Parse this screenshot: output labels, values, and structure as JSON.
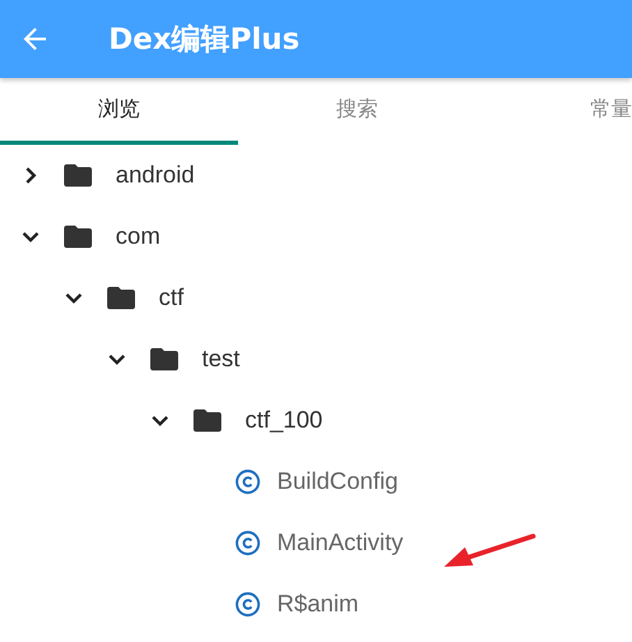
{
  "app_bar": {
    "title": "Dex编辑Plus"
  },
  "tabs": [
    {
      "label": "浏览",
      "selected": true
    },
    {
      "label": "搜索",
      "selected": false
    },
    {
      "label": "常量",
      "selected": false
    }
  ],
  "tree": [
    {
      "kind": "folder",
      "label": "android",
      "expanded": false
    },
    {
      "kind": "folder",
      "label": "com",
      "expanded": true,
      "children": [
        {
          "kind": "folder",
          "label": "ctf",
          "expanded": true,
          "children": [
            {
              "kind": "folder",
              "label": "test",
              "expanded": true,
              "children": [
                {
                  "kind": "folder",
                  "label": "ctf_100",
                  "expanded": true,
                  "children": [
                    {
                      "kind": "class",
                      "label": "BuildConfig"
                    },
                    {
                      "kind": "class",
                      "label": "MainActivity"
                    },
                    {
                      "kind": "class",
                      "label": "R$anim"
                    }
                  ]
                }
              ]
            }
          ]
        }
      ]
    }
  ]
}
